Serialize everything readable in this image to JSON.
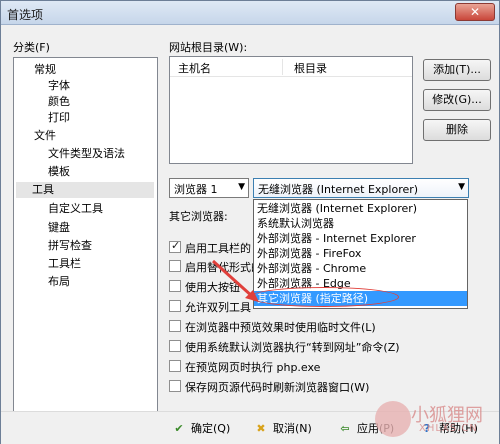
{
  "window": {
    "title": "首选项",
    "close_glyph": "✕"
  },
  "category_label": "分类(F)",
  "tree": [
    {
      "label": "常规"
    },
    {
      "label": "字体"
    },
    {
      "label": "颜色"
    },
    {
      "label": "打印"
    },
    {
      "label": "文件"
    },
    {
      "label": "文件类型及语法"
    },
    {
      "label": "模板"
    },
    {
      "label": "工具"
    },
    {
      "label": "自定义工具"
    },
    {
      "label": "键盘"
    },
    {
      "label": "拼写检查"
    },
    {
      "label": "工具栏"
    },
    {
      "label": "布局"
    }
  ],
  "site_root": {
    "label": "网站根目录(W):",
    "columns": [
      "主机名",
      "根目录"
    ]
  },
  "buttons": {
    "add": "添加(T)...",
    "edit": "修改(G)...",
    "delete": "删除"
  },
  "browser_select": {
    "value": "浏览器 1"
  },
  "browser_type_select": {
    "value": "无缝浏览器 (Internet Explorer)"
  },
  "other_browser_label": "其它浏览器:",
  "dropdown_options": [
    "无缝浏览器 (Internet Explorer)",
    "系统默认浏览器",
    "外部浏览器 - Internet Explorer",
    "外部浏览器 - FireFox",
    "外部浏览器 - Chrome",
    "外部浏览器 - Edge",
    "其它浏览器 (指定路径)"
  ],
  "checkboxes": [
    {
      "label": "启用工具栏的",
      "checked": true
    },
    {
      "label": "启用替代形式的",
      "checked": false
    },
    {
      "label": "使用大按钮",
      "checked": false
    },
    {
      "label": "允许双列工具",
      "checked": false
    },
    {
      "label": "在浏览器中预览效果时使用临时文件(L)",
      "checked": false
    },
    {
      "label": "使用系统默认浏览器执行“转到网址”命令(Z)",
      "checked": false
    },
    {
      "label": "在预览网页时执行 php.exe",
      "checked": false
    },
    {
      "label": "保存网页源代码时刷新浏览器窗口(W)",
      "checked": false
    }
  ],
  "footer": {
    "ok": "确定(Q)",
    "cancel": "取消(N)",
    "apply": "应用(P)",
    "help": "帮助(H)"
  },
  "watermark": {
    "text": "小狐狸网",
    "sub": "XHLXS.CN"
  }
}
